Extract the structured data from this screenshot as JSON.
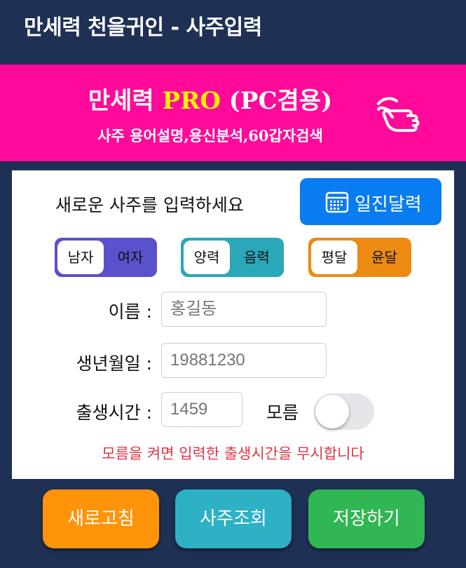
{
  "header": {
    "title": "만세력 천을귀인 - 사주입력"
  },
  "banner": {
    "title_main": "만세력 ",
    "title_pro": "PRO",
    "title_suffix": " (PC겸용)",
    "subtitle": "사주 용어설명,용신분석,60갑자검색",
    "icon": "tap-hand-icon",
    "colors": {
      "background": "#ff0a9a",
      "pro": "#fff200"
    }
  },
  "form": {
    "prompt": "새로운 사주를 입력하세요",
    "ilji_button": {
      "label": "일진달력",
      "icon": "calendar-icon",
      "color": "#0a7cf2"
    },
    "gender": {
      "options": [
        "남자",
        "여자"
      ],
      "selected": "남자",
      "color": "#5b51cc"
    },
    "calendar_type": {
      "options": [
        "양력",
        "음력"
      ],
      "selected": "양력",
      "color": "#2aa7b9"
    },
    "leap_month": {
      "options": [
        "평달",
        "윤달"
      ],
      "selected": "평달",
      "color": "#ec8a12"
    },
    "name": {
      "label": "이름 :",
      "placeholder": "홍길동",
      "value": ""
    },
    "birthdate": {
      "label": "생년월일 :",
      "placeholder": "19881230",
      "value": ""
    },
    "birthtime": {
      "label": "출생시간 :",
      "placeholder": "1459",
      "value": ""
    },
    "unknown_time": {
      "label": "모름",
      "on": false
    },
    "warning": "모름을 켜면 입력한 출생시간을 무시합니다"
  },
  "actions": {
    "refresh": {
      "label": "새로고침",
      "color": "#ff940a"
    },
    "view": {
      "label": "사주조회",
      "color": "#2eb0c5"
    },
    "save": {
      "label": "저장하기",
      "color": "#30b653"
    }
  }
}
